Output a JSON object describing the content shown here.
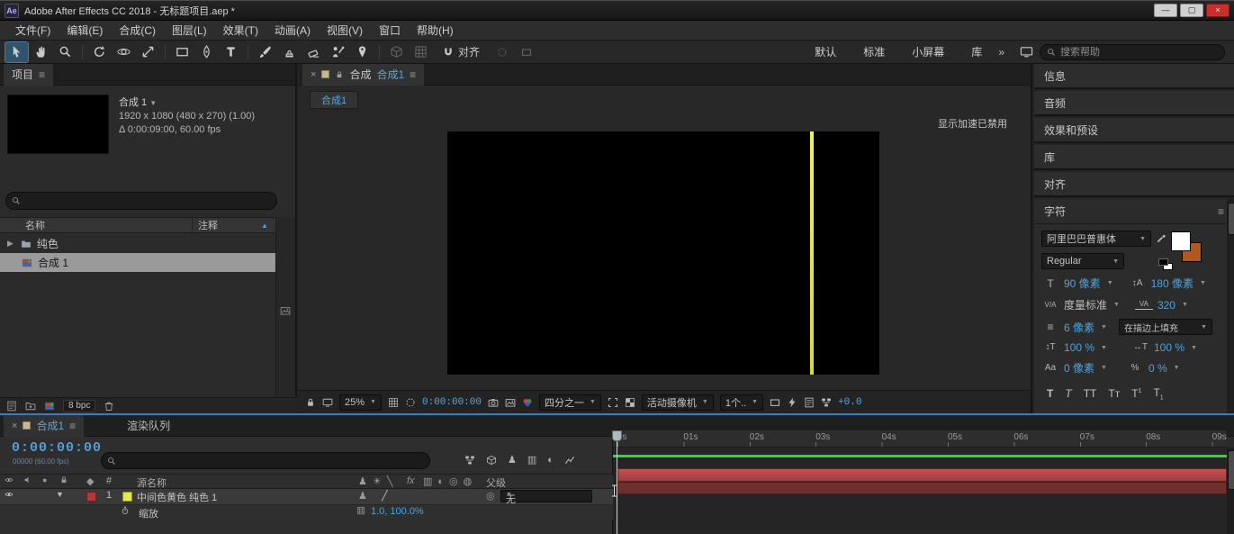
{
  "colors": {
    "accent_blue": "#57a7db",
    "timecode_blue": "#4f9fd8",
    "panel_bg": "#2b2b2b",
    "layer_bar_red": "#b04545",
    "render_cache_green": "#3ecf3e",
    "solid_yellow": "#e9e94f",
    "close_button_red": "#c9302c",
    "selected_row_gray": "#9a9a9a"
  },
  "titlebar": {
    "app_badge": "Ae",
    "title": "Adobe After Effects CC 2018 - 无标题项目.aep *"
  },
  "menubar": {
    "items": [
      "文件(F)",
      "编辑(E)",
      "合成(C)",
      "图层(L)",
      "效果(T)",
      "动画(A)",
      "视图(V)",
      "窗口",
      "帮助(H)"
    ]
  },
  "toolbar": {
    "tools": [
      "selection-tool",
      "hand-tool",
      "zoom-tool",
      "rotation-tool",
      "camera-tool",
      "pan-behind-tool",
      "rectangle-tool",
      "pen-tool",
      "type-tool",
      "brush-tool",
      "clone-stamp-tool",
      "eraser-tool",
      "roto-brush-tool",
      "puppet-pin-tool"
    ],
    "snap_label": "对齐",
    "workspaces": [
      "默认",
      "标准",
      "小屏幕",
      "库"
    ],
    "overflow": "»",
    "search_placeholder": "搜索帮助"
  },
  "project": {
    "tab": "项目",
    "preview": {
      "name": "合成 1",
      "dims": "1920 x 1080 (480 x 270) (1.00)",
      "duration": "Δ 0:00:09:00, 60.00 fps"
    },
    "columns": {
      "name": "名称",
      "comment": "注释"
    },
    "rows": [
      {
        "label": "纯色",
        "type": "folder"
      },
      {
        "label": "合成 1",
        "type": "composition",
        "selected": true
      }
    ],
    "bpc": "8 bpc"
  },
  "comp": {
    "panel_title": "合成",
    "active_comp": "合成1",
    "viewer_tab": "合成1",
    "notice": "显示加速已禁用",
    "zoom": "25%",
    "timecode": "0:00:00:00",
    "resolution": "四分之一",
    "camera": "活动摄像机",
    "views": "1个..",
    "exposure": "+0.0"
  },
  "right": {
    "panels": [
      "信息",
      "音频",
      "效果和预设",
      "库",
      "对齐"
    ],
    "character": {
      "title": "字符",
      "font_family": "阿里巴巴普惠体",
      "font_style": "Regular",
      "font_size": "90 像素",
      "leading": "180 像素",
      "kerning": "度量标准",
      "tracking": "320",
      "stroke_width": "6 像素",
      "fill_stroke_mode": "在描边上填充",
      "vertical_scale": "100 %",
      "horizontal_scale": "100 %",
      "baseline_shift": "0 像素",
      "tsume": "0 %"
    }
  },
  "timeline": {
    "tab": "合成1",
    "render_queue": "渲染队列",
    "timecode": "0:00:00:00",
    "frame_info": "00000 (60.00 fps)",
    "columns": {
      "index": "#",
      "source_name": "源名称",
      "parent": "父级"
    },
    "layer": {
      "index": "1",
      "name": "中间色黄色 纯色 1",
      "parent_value": "无"
    },
    "property": {
      "label": "缩放",
      "value": "1.0, 100.0%"
    },
    "ruler": [
      "0s",
      "01s",
      "02s",
      "03s",
      "04s",
      "05s",
      "06s",
      "07s",
      "08s",
      "09s"
    ]
  }
}
